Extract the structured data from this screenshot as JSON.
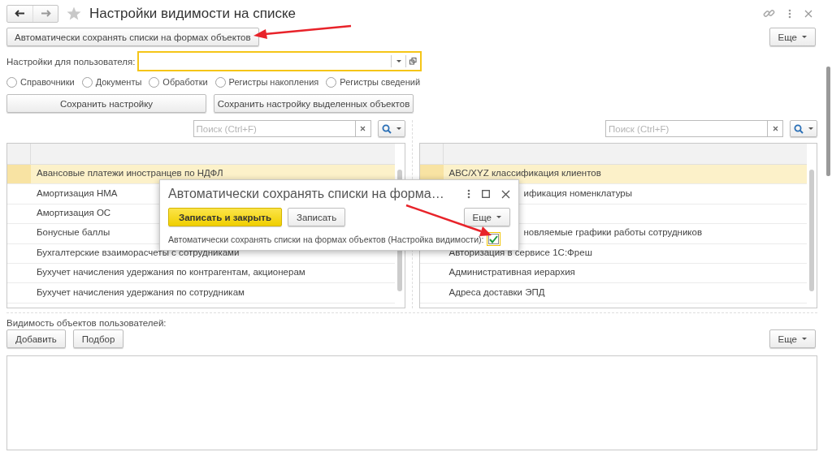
{
  "window": {
    "title": "Настройки видимости на списке"
  },
  "toolbar": {
    "auto_save_button": "Автоматически сохранять списки на формах объектов",
    "more_button": "Еще"
  },
  "user_field": {
    "label": "Настройки для пользователя:"
  },
  "object_types": [
    {
      "label": "Справочники",
      "selected": false
    },
    {
      "label": "Документы",
      "selected": false
    },
    {
      "label": "Обработки",
      "selected": false
    },
    {
      "label": "Регистры накопления",
      "selected": false
    },
    {
      "label": "Регистры сведений",
      "selected": false
    }
  ],
  "save_buttons": [
    "Сохранить настройку",
    "Сохранить настройку выделенных объектов"
  ],
  "lists": [
    {
      "search": {
        "placeholder": "Поиск (Ctrl+F)"
      },
      "rows": [
        {
          "kind": "row",
          "text": "Авансовые платежи иностранцев по НДФЛ",
          "selected": true
        },
        {
          "kind": "row",
          "text": "Амортизация НМА",
          "selected": false
        },
        {
          "kind": "row",
          "text": "Амортизация ОС",
          "selected": false
        },
        {
          "kind": "row",
          "text": "Бонусные баллы",
          "selected": false
        },
        {
          "kind": "row",
          "text": "Бухгалтерские взаиморасчеты с сотрудниками",
          "selected": false
        },
        {
          "kind": "row",
          "text": "Бухучет начисления удержания по контрагентам, акционерам",
          "selected": false
        },
        {
          "kind": "row",
          "text": "Бухучет начисления удержания по сотрудникам",
          "selected": false
        }
      ]
    },
    {
      "search": {
        "placeholder": "Поиск (Ctrl+F)"
      },
      "rows": [
        {
          "kind": "row",
          "text": "ABC/XYZ классификация клиентов",
          "selected": true
        },
        {
          "kind": "partly-covered",
          "text": "ификация номенклатуры",
          "selected": false
        },
        {
          "kind": "covered",
          "selected": false
        },
        {
          "kind": "partly-covered",
          "text": "новляемые графики работы сотрудников",
          "selected": false
        },
        {
          "kind": "row",
          "text": "Авторизация в сервисе 1С:Фреш",
          "selected": false
        },
        {
          "kind": "row",
          "text": "Административная иерархия",
          "selected": false
        },
        {
          "kind": "row",
          "text": "Адреса доставки ЭПД",
          "selected": false
        }
      ]
    }
  ],
  "user_visibility": {
    "label": "Видимость объектов пользователей:",
    "buttons": [
      "Добавить",
      "Подбор"
    ],
    "more_button": "Еще"
  },
  "dialog": {
    "title": "Автоматически сохранять списки на форма…",
    "primary_button": "Записать и закрыть",
    "secondary_button": "Записать",
    "more_button": "Еще",
    "checkbox": {
      "label": "Автоматически сохранять списки на формах объектов (Настройка видимости):",
      "checked": true
    }
  }
}
